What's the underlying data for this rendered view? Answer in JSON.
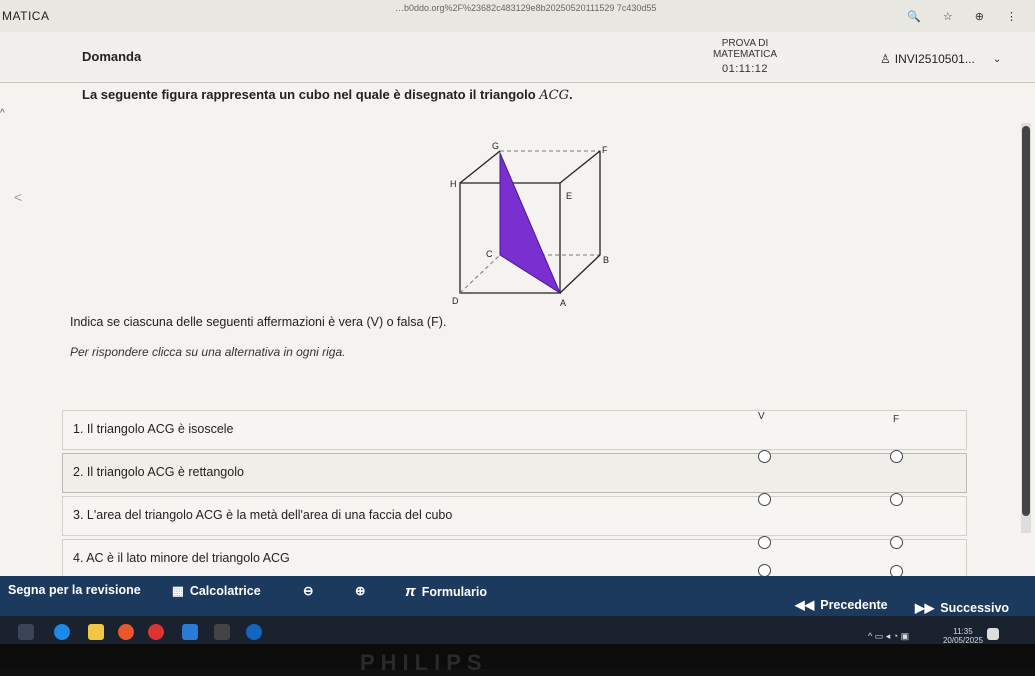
{
  "browser": {
    "brand": "MATICA",
    "url": "…b0ddo.org%2F%23682c483129e8b20250520111529 7c430d55"
  },
  "header": {
    "section": "Domanda",
    "test_title": "PROVA DI MATEMATICA",
    "timer": "01:11:12",
    "user": "INVI2510501..."
  },
  "question": {
    "prompt": "La seguente figura rappresenta un cubo nel quale è disegnato il triangolo ",
    "triangle": "ACG",
    "prompt_end": ".",
    "instruction": "Indica se ciascuna delle seguenti affermazioni è vera (V) o falsa (F).",
    "hint": "Per rispondere clicca su una alternativa in ogni riga."
  },
  "cube_labels": {
    "G": "G",
    "F": "F",
    "H": "H",
    "E": "E",
    "C": "C",
    "B": "B",
    "D": "D",
    "A": "A"
  },
  "table": {
    "col_v": "V",
    "col_f": "F",
    "rows": [
      "1. Il triangolo ACG è isoscele",
      "2. Il triangolo ACG è rettangolo",
      "3. L'area del triangolo ACG è la metà dell'area di una faccia del cubo",
      "4. AC è il lato minore del triangolo ACG"
    ]
  },
  "footer": {
    "review": "Segna per la revisione",
    "calculator": "Calcolatrice",
    "formulary": "Formulario",
    "pi_symbol": "π",
    "prev": "Precedente",
    "next": "Successivo"
  },
  "system": {
    "time": "11:35",
    "date": "20/05/2025"
  },
  "bezel": {
    "brand": "PHILIPS"
  },
  "colors": {
    "triangle_fill": "#7a2fd0",
    "footer_bg": "#1c3a5e"
  }
}
